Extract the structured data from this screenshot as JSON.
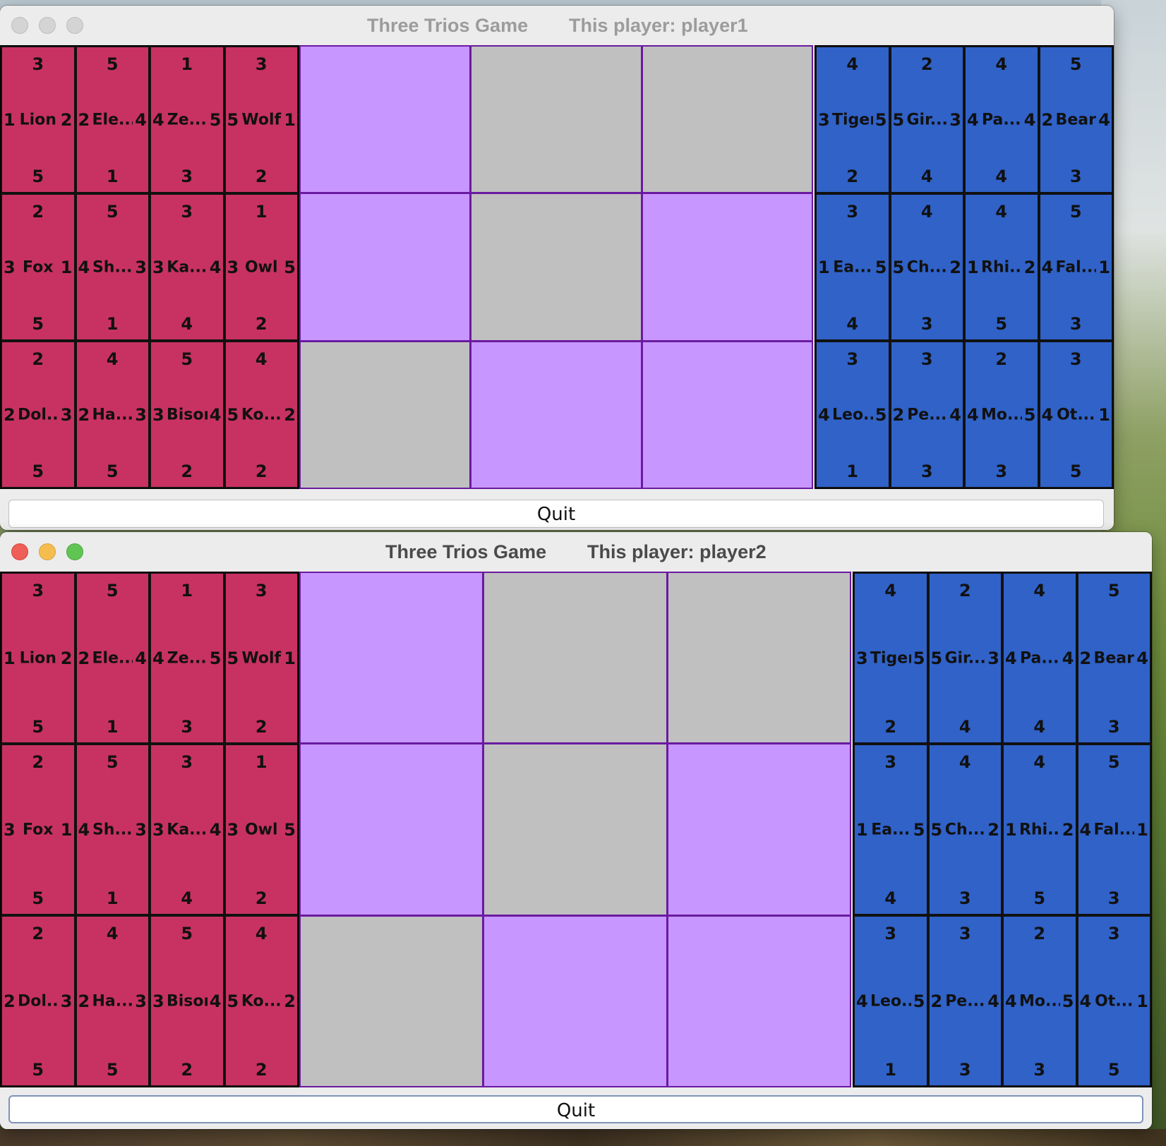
{
  "windows": [
    {
      "title": "Three Trios Game",
      "player_label": "This player: player1",
      "quit_label": "Quit"
    },
    {
      "title": "Three Trios Game",
      "player_label": "This player: player2",
      "quit_label": "Quit"
    }
  ],
  "red_hand": [
    {
      "name": "Lion",
      "n": "3",
      "s": "5",
      "w": "1",
      "e": "2"
    },
    {
      "name": "Ele...",
      "n": "5",
      "s": "1",
      "w": "2",
      "e": "4"
    },
    {
      "name": "Ze...",
      "n": "1",
      "s": "3",
      "w": "4",
      "e": "5"
    },
    {
      "name": "Wolf",
      "n": "3",
      "s": "2",
      "w": "5",
      "e": "1"
    },
    {
      "name": "Fox",
      "n": "2",
      "s": "5",
      "w": "3",
      "e": "1"
    },
    {
      "name": "Sh...",
      "n": "5",
      "s": "1",
      "w": "4",
      "e": "3"
    },
    {
      "name": "Ka...",
      "n": "3",
      "s": "4",
      "w": "3",
      "e": "4"
    },
    {
      "name": "Owl",
      "n": "1",
      "s": "2",
      "w": "3",
      "e": "5"
    },
    {
      "name": "Dol...",
      "n": "2",
      "s": "5",
      "w": "2",
      "e": "3"
    },
    {
      "name": "Ha...",
      "n": "4",
      "s": "5",
      "w": "2",
      "e": "3"
    },
    {
      "name": "Bison",
      "n": "5",
      "s": "2",
      "w": "3",
      "e": "4"
    },
    {
      "name": "Ko...",
      "n": "4",
      "s": "2",
      "w": "5",
      "e": "2"
    }
  ],
  "blue_hand": [
    {
      "name": "Tiger",
      "n": "4",
      "s": "2",
      "w": "3",
      "e": "5"
    },
    {
      "name": "Gir...",
      "n": "2",
      "s": "4",
      "w": "5",
      "e": "3"
    },
    {
      "name": "Pa...",
      "n": "4",
      "s": "4",
      "w": "4",
      "e": "4"
    },
    {
      "name": "Bear",
      "n": "5",
      "s": "3",
      "w": "2",
      "e": "4"
    },
    {
      "name": "Ea...",
      "n": "3",
      "s": "4",
      "w": "1",
      "e": "5"
    },
    {
      "name": "Ch...",
      "n": "4",
      "s": "3",
      "w": "5",
      "e": "2"
    },
    {
      "name": "Rhi...",
      "n": "4",
      "s": "5",
      "w": "1",
      "e": "2"
    },
    {
      "name": "Fal...",
      "n": "5",
      "s": "3",
      "w": "4",
      "e": "1"
    },
    {
      "name": "Leo...",
      "n": "3",
      "s": "1",
      "w": "4",
      "e": "5"
    },
    {
      "name": "Pe...",
      "n": "3",
      "s": "3",
      "w": "2",
      "e": "4"
    },
    {
      "name": "Mo...",
      "n": "2",
      "s": "3",
      "w": "4",
      "e": "5"
    },
    {
      "name": "Ot...",
      "n": "3",
      "s": "5",
      "w": "4",
      "e": "1"
    }
  ],
  "board": [
    [
      "card",
      "hole",
      "hole"
    ],
    [
      "card",
      "hole",
      "card"
    ],
    [
      "hole",
      "card",
      "card"
    ]
  ],
  "colors": {
    "red_player": "#c83262",
    "blue_player": "#3062c8",
    "card_cell": "#c896ff",
    "hole": "#c0c0c0",
    "grid_line": "#6a1aa0"
  }
}
